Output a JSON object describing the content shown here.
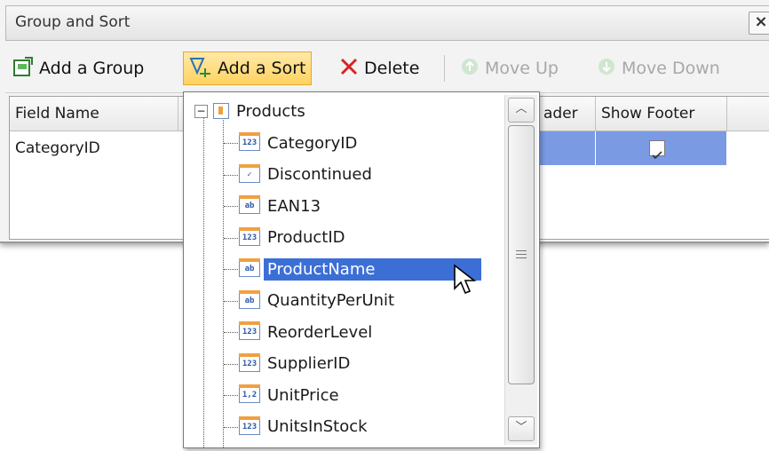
{
  "window": {
    "title": "Group and Sort",
    "close_label": "×"
  },
  "toolbar": {
    "add_group_label": "Add a Group",
    "add_sort_label": "Add a Sort",
    "delete_label": "Delete",
    "move_up_label": "Move Up",
    "move_down_label": "Move Down"
  },
  "grid": {
    "headers": [
      "Field Name",
      "ader",
      "Show Footer"
    ],
    "rows": [
      {
        "field_name": "CategoryID",
        "show_footer_checked": true
      }
    ]
  },
  "dropdown": {
    "root": {
      "label": "Products",
      "icon": "table-icon",
      "expander": "−"
    },
    "fields": [
      {
        "label": "CategoryID",
        "icon": "123",
        "selected": false
      },
      {
        "label": "Discontinued",
        "icon": "✓",
        "selected": false
      },
      {
        "label": "EAN13",
        "icon": "ab",
        "selected": false
      },
      {
        "label": "ProductID",
        "icon": "123",
        "selected": false
      },
      {
        "label": "ProductName",
        "icon": "ab",
        "selected": true
      },
      {
        "label": "QuantityPerUnit",
        "icon": "ab",
        "selected": false
      },
      {
        "label": "ReorderLevel",
        "icon": "123",
        "selected": false
      },
      {
        "label": "SupplierID",
        "icon": "123",
        "selected": false
      },
      {
        "label": "UnitPrice",
        "icon": "1,2",
        "selected": false
      },
      {
        "label": "UnitsInStock",
        "icon": "123",
        "selected": false
      }
    ]
  },
  "colors": {
    "selection": "#3c6fd6",
    "row_selection": "#7a9be4",
    "active_button": "#ffd260"
  }
}
